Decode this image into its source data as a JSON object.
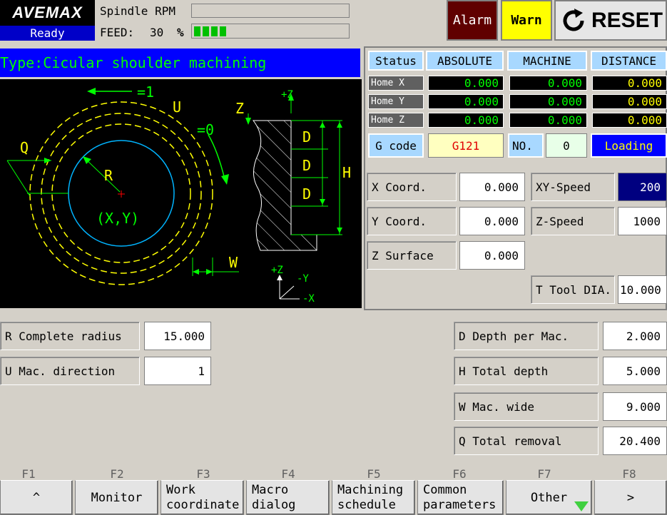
{
  "header": {
    "logo": "AVEMAX",
    "status": "Ready",
    "spindle_label": "Spindle RPM",
    "feed_label": "FEED:",
    "feed_value": "30",
    "feed_unit": "%",
    "feed_level_fraction": 0.22,
    "alarm_label": "Alarm",
    "warn_label": "Warn",
    "reset_label": "RESET"
  },
  "type_bar": "Type:Cicular shoulder machining",
  "diagram": {
    "labels": {
      "dir1": "=1",
      "dir0": "=0",
      "u": "U",
      "q": "Q",
      "r": "R",
      "center": "(X,Y)",
      "w": "W",
      "z": "Z",
      "plus_z": "+Z",
      "d1": "D",
      "d2": "D",
      "d3": "D",
      "h": "H",
      "axis_z": "+Z",
      "axis_y": "-Y",
      "axis_x": "-X"
    }
  },
  "status_table": {
    "headers": [
      "Status",
      "ABSOLUTE",
      "MACHINE",
      "DISTANCE"
    ],
    "rows": [
      {
        "label": "Home X",
        "absolute": "0.000",
        "machine": "0.000",
        "distance": "0.000"
      },
      {
        "label": "Home Y",
        "absolute": "0.000",
        "machine": "0.000",
        "distance": "0.000"
      },
      {
        "label": "Home Z",
        "absolute": "0.000",
        "machine": "0.000",
        "distance": "0.000"
      }
    ],
    "gcode_label": "G code",
    "gcode_value": "G121",
    "no_label": "NO.",
    "no_value": "0",
    "loading_label": "Loading"
  },
  "coords": {
    "x_label": "X Coord.",
    "x_value": "0.000",
    "y_label": "Y Coord.",
    "y_value": "0.000",
    "z_label": "Z Surface",
    "z_value": "0.000",
    "xy_speed_label": "XY-Speed",
    "xy_speed_value": "200",
    "z_speed_label": "Z-Speed",
    "z_speed_value": "1000",
    "tool_label": "T Tool DIA.",
    "tool_value": "10.000"
  },
  "params": {
    "r_label": "R Complete radius",
    "r_value": "15.000",
    "u_label": "U Mac. direction",
    "u_value": "1",
    "d_label": "D Depth per Mac.",
    "d_value": "2.000",
    "h_label": "H Total depth",
    "h_value": "5.000",
    "w_label": "W Mac. wide",
    "w_value": "9.000",
    "q_label": "Q Total removal",
    "q_value": "20.400"
  },
  "fkeys": {
    "labels": [
      "F1",
      "F2",
      "F3",
      "F4",
      "F5",
      "F6",
      "F7",
      "F8"
    ],
    "buttons": [
      {
        "line1": "^",
        "line2": ""
      },
      {
        "line1": "Monitor",
        "line2": ""
      },
      {
        "line1": "Work",
        "line2": "coordinate"
      },
      {
        "line1": "Macro",
        "line2": "dialog"
      },
      {
        "line1": "Machining",
        "line2": "schedule"
      },
      {
        "line1": "Common",
        "line2": "parameters"
      },
      {
        "line1": "Other",
        "line2": ""
      },
      {
        "line1": ">",
        "line2": ""
      }
    ]
  }
}
